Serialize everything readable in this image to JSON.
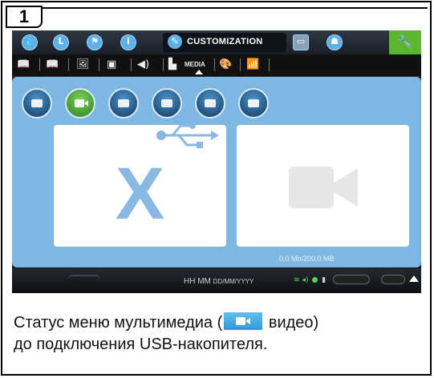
{
  "badge": {
    "number": "1"
  },
  "top_bar": {
    "icons": [
      "water-drop-icon",
      "clock-icon",
      "flag-icon",
      "info-icon"
    ],
    "customization_label": "CUSTOMIZATION",
    "right_icons": [
      "screen-icon",
      "profile-icon",
      "wrench-icon"
    ],
    "active_color": "#5cb533"
  },
  "second_bar": {
    "media_label": "MEDIA",
    "icons": [
      "book-icon",
      "book-open-icon",
      "photo-frame-icon",
      "display-icon",
      "speaker-icon",
      "media-icon",
      "palette-icon",
      "wifi-icon"
    ]
  },
  "media_buttons": [
    {
      "name": "photo-button",
      "active": false
    },
    {
      "name": "video-button",
      "active": true
    },
    {
      "name": "audio-button",
      "active": false
    },
    {
      "name": "disc-button",
      "active": false
    },
    {
      "name": "slideshow-button",
      "active": false
    },
    {
      "name": "grid-button",
      "active": false
    }
  ],
  "storage_text": "0.0 Mb/200.0 MB",
  "status_bar": {
    "time": "HH MM",
    "date": "DD/MM/YYYY"
  },
  "caption": {
    "before": "Статус меню мультимедиа (",
    "after": " видео)",
    "line2": "до подключения USB-накопителя."
  },
  "colors": {
    "panel_blue": "#7fb7e3",
    "accent_green": "#5cb533",
    "x_blue": "#89b9e2"
  }
}
